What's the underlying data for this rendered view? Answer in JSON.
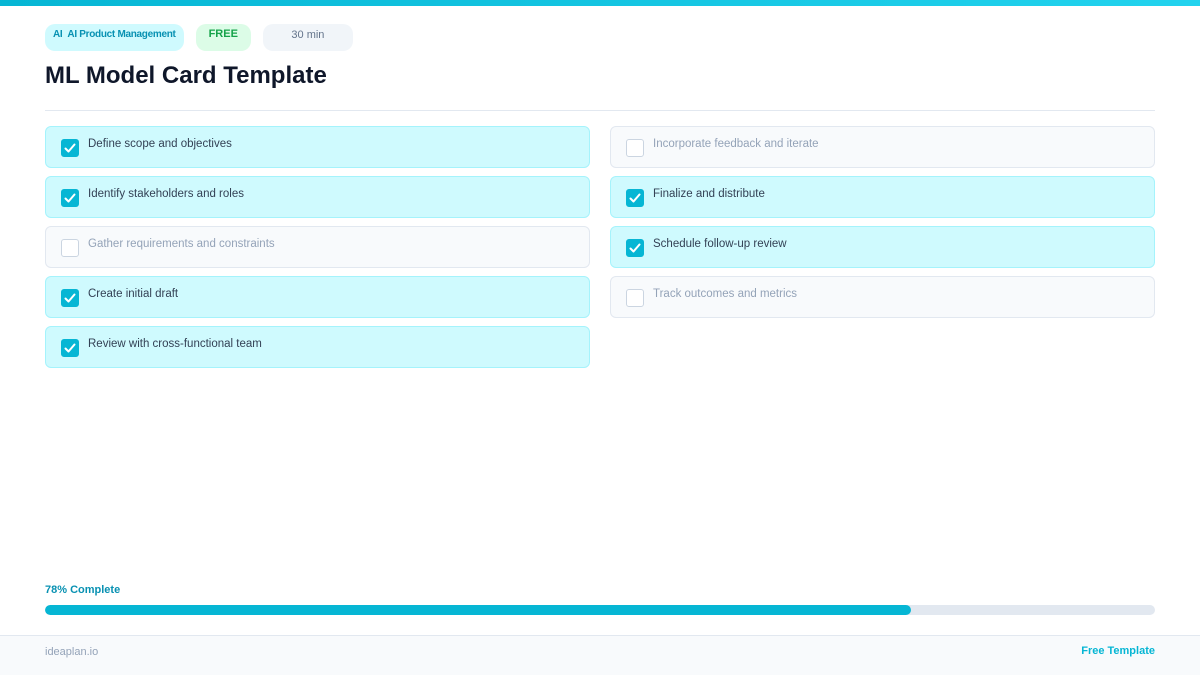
{
  "header": {
    "category_icon": "AI",
    "category_label": "AI Product Management",
    "price_badge": "FREE",
    "duration_badge": "30 min",
    "title": "ML Model Card Template"
  },
  "checklist": {
    "left": [
      {
        "label": "Define scope and objectives",
        "checked": true
      },
      {
        "label": "Identify stakeholders and roles",
        "checked": true
      },
      {
        "label": "Gather requirements and constraints",
        "checked": false
      },
      {
        "label": "Create initial draft",
        "checked": true
      },
      {
        "label": "Review with cross-functional team",
        "checked": true
      }
    ],
    "right": [
      {
        "label": "Incorporate feedback and iterate",
        "checked": false
      },
      {
        "label": "Finalize and distribute",
        "checked": true
      },
      {
        "label": "Schedule follow-up review",
        "checked": true
      },
      {
        "label": "Track outcomes and metrics",
        "checked": false
      }
    ]
  },
  "progress": {
    "label": "78% Complete",
    "percent": 78
  },
  "footer": {
    "site": "ideaplan.io",
    "tag": "Free Template"
  },
  "colors": {
    "accent": "#06b6d4",
    "accent_dark": "#0891b2",
    "done_bg": "#cffafe",
    "free_green": "#16a34a"
  }
}
